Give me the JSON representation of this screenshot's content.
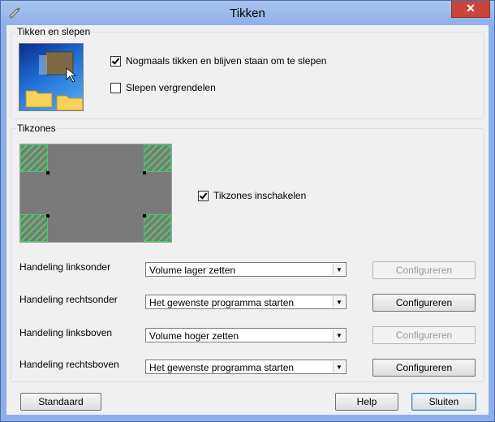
{
  "window": {
    "title": "Tikken",
    "close_symbol": "✕"
  },
  "group_drag": {
    "legend": "Tikken en slepen",
    "options": [
      {
        "label": "Nogmaals tikken en blijven staan om te slepen",
        "checked": true
      },
      {
        "label": "Slepen vergrendelen",
        "checked": false
      }
    ]
  },
  "group_zones": {
    "legend": "Tikzones",
    "enable": {
      "label": "Tikzones inschakelen",
      "checked": true
    },
    "actions": [
      {
        "label": "Handeling linksonder",
        "value": "Volume lager zetten",
        "configure": "Configureren",
        "enabled": false
      },
      {
        "label": "Handeling rechtsonder",
        "value": "Het gewenste programma starten",
        "configure": "Configureren",
        "enabled": true
      },
      {
        "label": "Handeling linksboven",
        "value": "Volume hoger zetten",
        "configure": "Configureren",
        "enabled": false
      },
      {
        "label": "Handeling rechtsboven",
        "value": "Het gewenste programma starten",
        "configure": "Configureren",
        "enabled": true
      }
    ]
  },
  "footer": {
    "default_label": "Standaard",
    "help_label": "Help",
    "close_label": "Sluiten"
  },
  "colors": {
    "titlebar": "#8db0e8",
    "close": "#c7453a",
    "zone_green": "#4fd05f"
  },
  "icons": {
    "system": "pen-icon",
    "dropdown": "chevron-down-icon"
  }
}
